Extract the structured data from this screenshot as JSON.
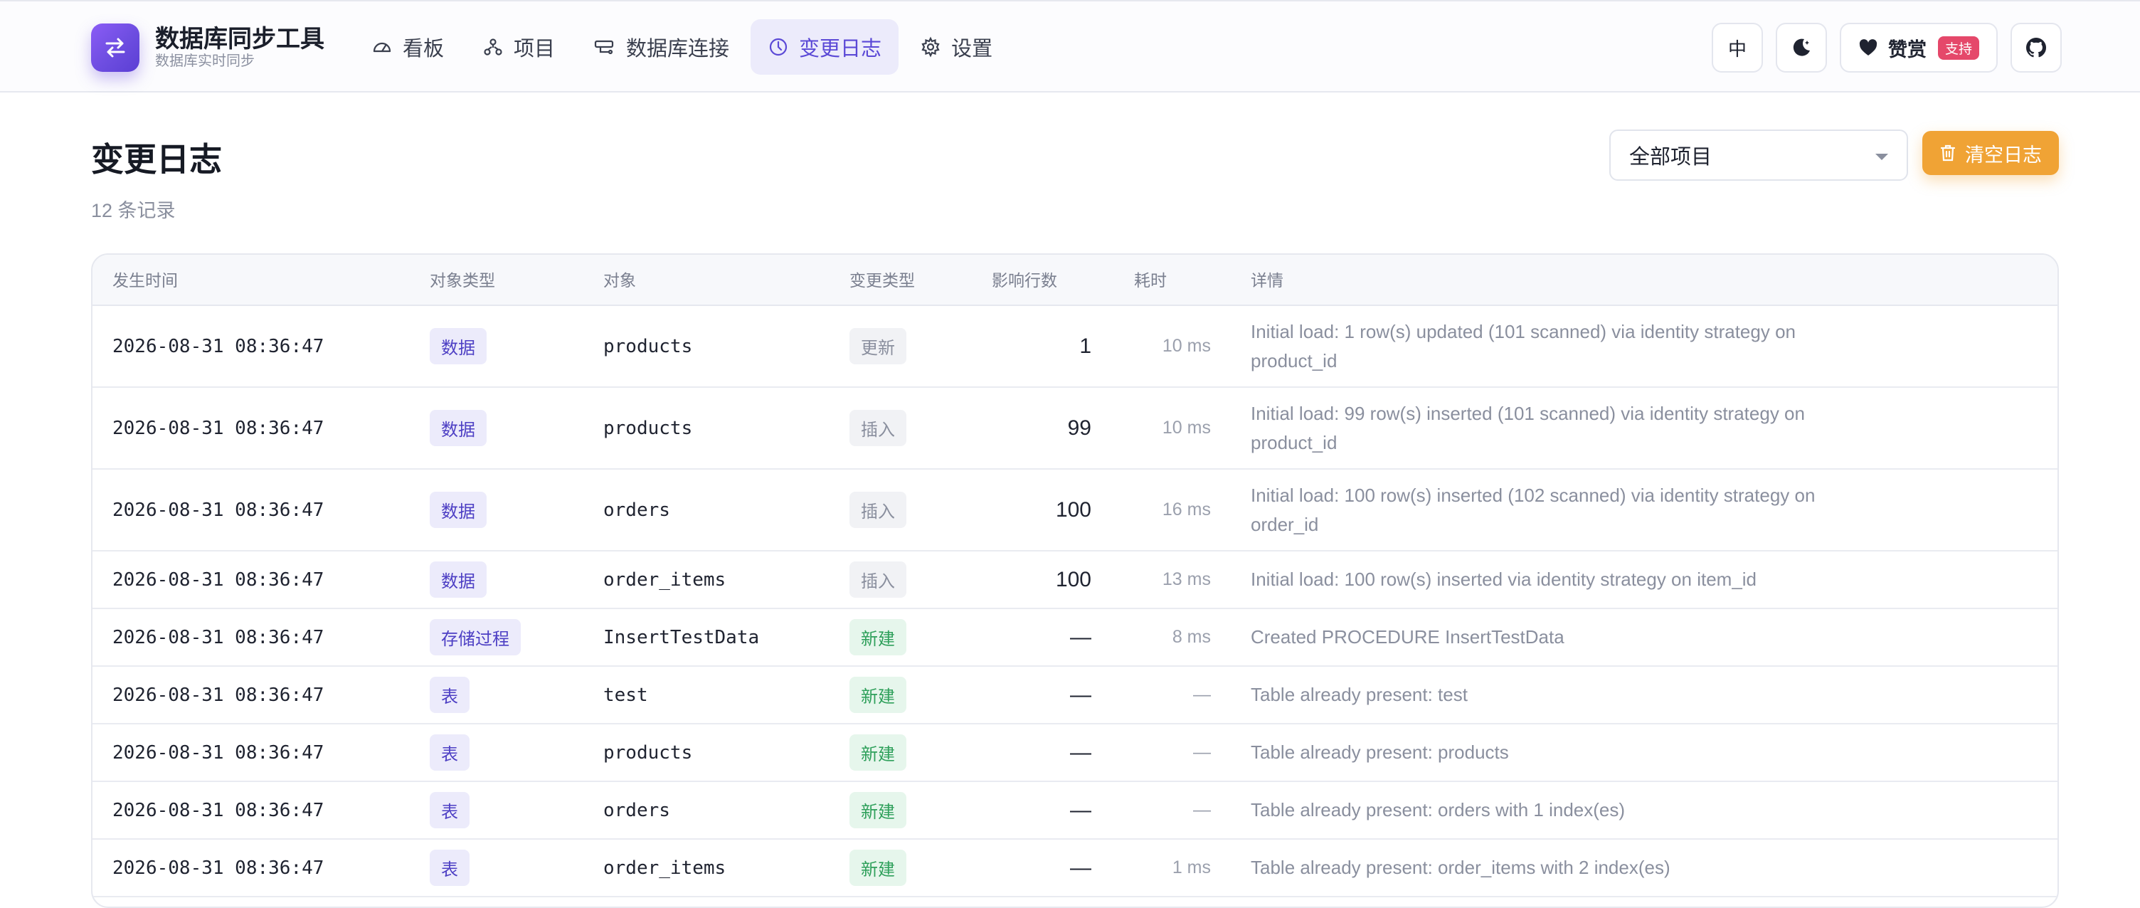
{
  "app": {
    "title": "数据库同步工具",
    "subtitle": "数据库实时同步"
  },
  "nav": {
    "items": [
      {
        "label": "看板",
        "icon": "dashboard-icon"
      },
      {
        "label": "项目",
        "icon": "project-tree-icon"
      },
      {
        "label": "数据库连接",
        "icon": "database-connection-icon"
      },
      {
        "label": "变更日志",
        "icon": "clock-icon",
        "active": true
      },
      {
        "label": "设置",
        "icon": "gear-icon"
      }
    ]
  },
  "toolbar": {
    "language_label": "中",
    "theme_icon": "moon-icon",
    "sponsor_label": "赞赏",
    "support_badge": "支持",
    "github_icon": "github-icon"
  },
  "page": {
    "title": "变更日志",
    "record_count": "12 条记录",
    "project_filter": "全部项目",
    "clear_button": "清空日志"
  },
  "colors": {
    "accent": "#5b49d6",
    "accent_bg": "#ecebfb",
    "clear_button": "#f0a335",
    "new_badge": "#2fa05b",
    "support_badge": "#e5486a"
  },
  "table": {
    "columns": [
      "发生时间",
      "对象类型",
      "对象",
      "变更类型",
      "影响行数",
      "耗时",
      "详情"
    ],
    "rows": [
      {
        "time": "2026-08-31 08:36:47",
        "object_type": "数据",
        "object": "products",
        "change": "更新",
        "change_kind": "neutral",
        "rows": "1",
        "duration": "10 ms",
        "detail": "Initial load: 1 row(s) updated (101 scanned) via identity strategy on product_id"
      },
      {
        "time": "2026-08-31 08:36:47",
        "object_type": "数据",
        "object": "products",
        "change": "插入",
        "change_kind": "neutral",
        "rows": "99",
        "duration": "10 ms",
        "detail": "Initial load: 99 row(s) inserted (101 scanned) via identity strategy on product_id"
      },
      {
        "time": "2026-08-31 08:36:47",
        "object_type": "数据",
        "object": "orders",
        "change": "插入",
        "change_kind": "neutral",
        "rows": "100",
        "duration": "16 ms",
        "detail": "Initial load: 100 row(s) inserted (102 scanned) via identity strategy on order_id"
      },
      {
        "time": "2026-08-31 08:36:47",
        "object_type": "数据",
        "object": "order_items",
        "change": "插入",
        "change_kind": "neutral",
        "rows": "100",
        "duration": "13 ms",
        "detail": "Initial load: 100 row(s) inserted via identity strategy on item_id"
      },
      {
        "time": "2026-08-31 08:36:47",
        "object_type": "存储过程",
        "object": "InsertTestData",
        "change": "新建",
        "change_kind": "new",
        "rows": "—",
        "duration": "8 ms",
        "detail": "Created PROCEDURE InsertTestData"
      },
      {
        "time": "2026-08-31 08:36:47",
        "object_type": "表",
        "object": "test",
        "change": "新建",
        "change_kind": "new",
        "rows": "—",
        "duration": "—",
        "detail": "Table already present: test"
      },
      {
        "time": "2026-08-31 08:36:47",
        "object_type": "表",
        "object": "products",
        "change": "新建",
        "change_kind": "new",
        "rows": "—",
        "duration": "—",
        "detail": "Table already present: products"
      },
      {
        "time": "2026-08-31 08:36:47",
        "object_type": "表",
        "object": "orders",
        "change": "新建",
        "change_kind": "new",
        "rows": "—",
        "duration": "—",
        "detail": "Table already present: orders with 1 index(es)"
      },
      {
        "time": "2026-08-31 08:36:47",
        "object_type": "表",
        "object": "order_items",
        "change": "新建",
        "change_kind": "new",
        "rows": "—",
        "duration": "1 ms",
        "detail": "Table already present: order_items with 2 index(es)"
      }
    ]
  }
}
